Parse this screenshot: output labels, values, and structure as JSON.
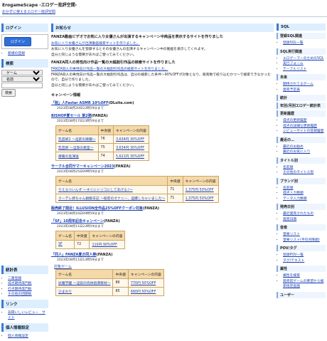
{
  "header": {
    "title": "ErogameScape -エロゲー批評空間-",
    "subtitle": "おかずに使えるエロゲー批評空間"
  },
  "left": {
    "login_section": "ログイン",
    "login_button": "ログイン",
    "register_link": "新規の登録",
    "search_section": "検索",
    "search_type": "ゲーム",
    "search_field": "名前",
    "search_button": "検索",
    "stats_section": "統計表",
    "stats_items": [
      "二重登録",
      "得点期待席門板",
      "打点期待席門板",
      "その他の回題板"
    ],
    "links_section": "リンク",
    "links_items": [
      "非掲いしいレビュー　サイト"
    ],
    "personal_section": "個人情報設定",
    "personal_items": [
      "個人情報設定"
    ]
  },
  "main": {
    "section": "お知らせ",
    "notices": [
      {
        "title": "FANZA動画ビデオでお気に入り女優さんが出演するキャンペーン中商品を表示するサイトを作りました",
        "lines": [
          "お気に入り女優さんが出演動画検索サイトを作りました。",
          "お気に入り女優さんを登録するとその女優さんの出演するキャンペーン中の動画を表示してくれます。",
          "自分と同じような需要があればご使ってみてください。"
        ]
      },
      {
        "title": "FANZA同人の男性向け作品一覧の大幅割引作品の検索サイトを作りました",
        "lines": [
          "FANZA同人の男性向け作品一覧の大幅割引作品の検索サイトを作りました。",
          "FANZA同人の男性向け作品一覧の大幅割引作品は、自分の検索した条件～90%OFFが対象となり、販売数で絞り込むかつ～で検索できなかったので、自分で作りました。",
          "自分と同じような需要があればご使ってみてください。"
        ]
      }
    ],
    "campaign_heading": "キャンペーン情報",
    "th_game": "ゲーム名",
    "th_median": "中央値",
    "th_content": "キャンペーンの内容",
    "campaigns": [
      {
        "title": "「割」人Fastar ASMR 10%OFF",
        "source": "(DLsite.com)",
        "date": "2023年08月20日23時59分まで",
        "rows": []
      },
      {
        "title": "BISHOP夏セール 第2弾",
        "source": "(FANZA)",
        "date": "2023年08月17日23時59分まで",
        "rows": [
          {
            "game": "乳首姉2 ～淫欲の蹂躙～",
            "median": "76",
            "content": "3,634円 30%OFF"
          },
          {
            "game": "乳首姉 ～淫辱の教室～",
            "median": "75",
            "content": "3,634円 30%OFF"
          },
          {
            "game": "療霧の島渾送",
            "median": "74",
            "content": "5,621円 30%OFF"
          }
        ]
      },
      {
        "title": "サークル合同サマーキャンペーン2023",
        "source": "(FANZA)",
        "date": "2023年08月25日09時59分まで",
        "rows": [
          {
            "game": "りえるついんず ～すぐにトリコにしてあげる♪～",
            "median": "71",
            "content": "1,375円 50%OFF"
          },
          {
            "game": "クーデレ姉ちゃん観察日記 ～秘密のオナニー、盗撮しちゃいました～",
            "median": "71",
            "content": "1,375円 50%OFF"
          }
        ]
      },
      {
        "title": "販売終了間近！ILLUSION全作品25%OFFクーポン対象",
        "source": "(FANZA)",
        "date": "2023年08月16日09時59分まで",
        "rows": []
      },
      {
        "title": "「SF」10周年記念キャンペーン",
        "source": "(FANZA)",
        "date": "2023年08月11日23時59分まで",
        "rows": [
          {
            "game": "SF",
            "median": "72",
            "content": "110円 90%OFF"
          }
        ]
      },
      {
        "title": "「同人」FANZA夏の同人祭",
        "source": "(FANZA)",
        "date": "2023年08月11日13時59分まで",
        "subhead": "対象ゲーム",
        "rows": [
          {
            "game": "妖魔学園 ～淫獄の肉体指導教材～",
            "median": "86",
            "content": "770円 50%OFF"
          },
          {
            "game": "ひまわり",
            "median": "85",
            "content": "660円 50%OFF"
          }
        ]
      }
    ]
  },
  "right": {
    "sql_section": "SQL",
    "sql_groups": [
      {
        "title": "登録SQL関連",
        "items": [
          "登録SQL一覧"
        ]
      },
      {
        "title": "SQL実行関連",
        "items": [
          "エロゲーマーのためのSQL",
          "実行フォーム",
          "テーブルリスト"
        ]
      },
      {
        "title": "未来",
        "items": [
          "期待されてるゲーム",
          "発売予定表"
        ]
      },
      {
        "title": "統計",
        "items": []
      },
      {
        "title": "年別/月別エロゲー統計表",
        "items": []
      },
      {
        "title": "更新履歴",
        "items": [
          "得点の更新履歴",
          "得点の詳細な更新履歴",
          "レビューサイトの登録履歴"
        ]
      },
      {
        "title": "最近の…",
        "items": [
          "最近のお勧め",
          "最近のお気に入り"
        ]
      },
      {
        "title": "タイトル別",
        "items": [
          "名前順",
          "その他のタイトル別"
        ]
      },
      {
        "title": "ブランド別",
        "items": [
          "名前順",
          "得点入力数順",
          "データ入力数順"
        ]
      },
      {
        "title": "発売日別",
        "items": [
          "最近発売されたもの",
          "発売日順"
        ]
      },
      {
        "title": "音楽",
        "items": [
          "音楽リスト",
          "音楽リスト(平均点降順)"
        ]
      },
      {
        "title": "POV/タグ",
        "items": [
          "登録POV一覧",
          "タグ/テキスト"
        ]
      },
      {
        "title": "属性",
        "items": [
          "属性を検索",
          "発売前ゲームの要望から検索指定画面"
        ]
      },
      {
        "title": "ユーザー",
        "items": []
      }
    ]
  }
}
